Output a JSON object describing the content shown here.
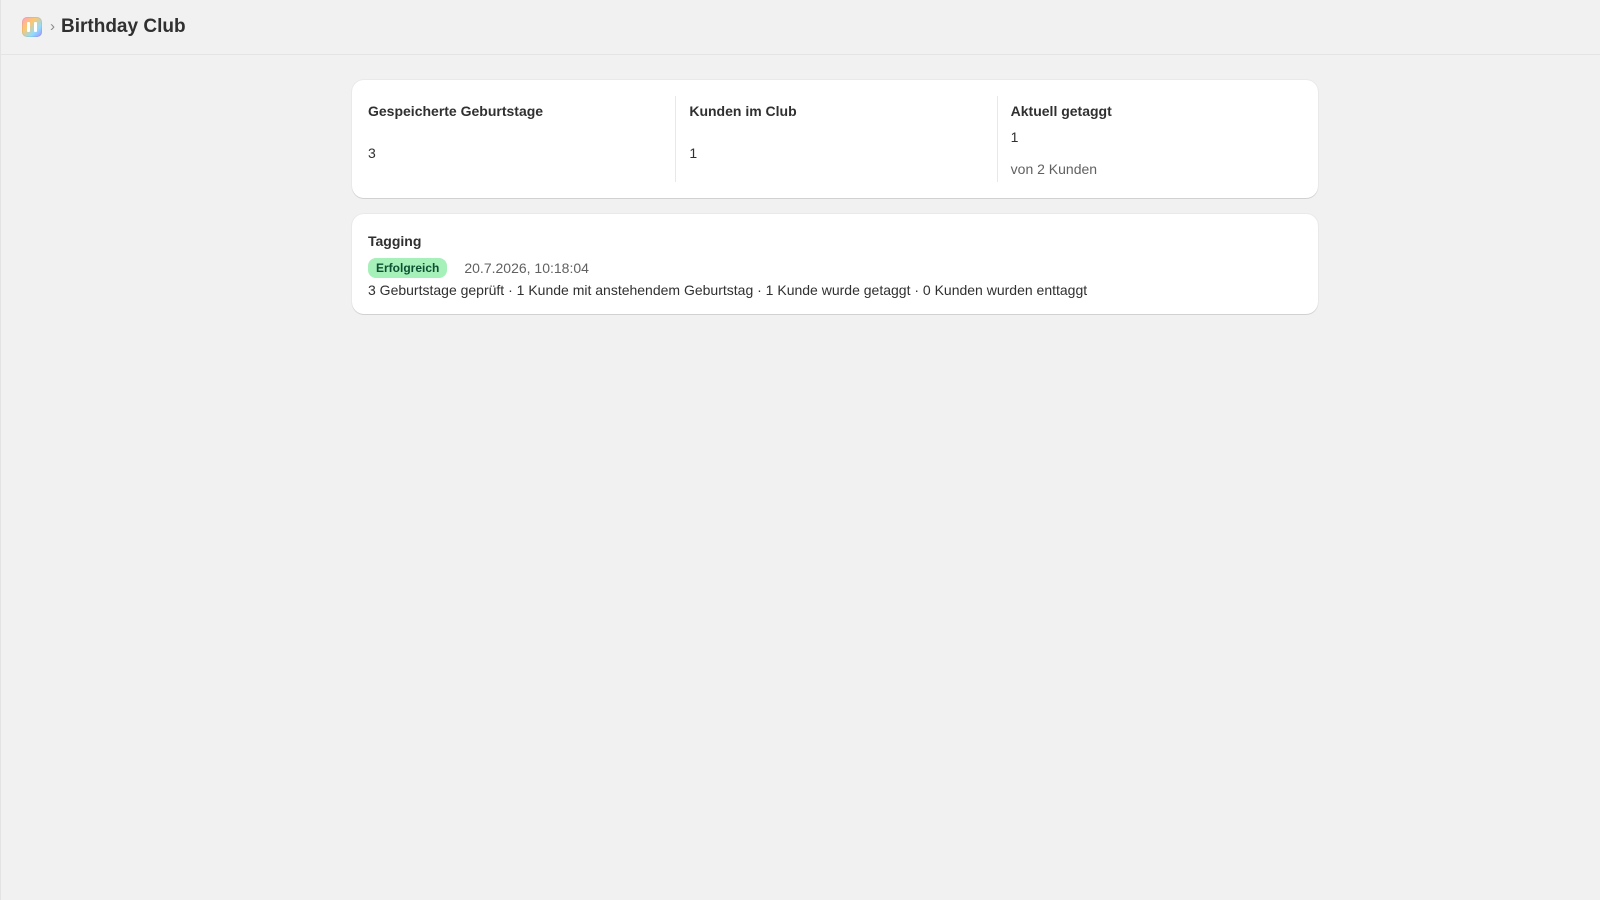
{
  "header": {
    "app_icon": "app-logo-icon",
    "separator": "›",
    "title": "Birthday Club"
  },
  "stats": {
    "saved_birthdays": {
      "label": "Gespeicherte Geburtstage",
      "value": "3"
    },
    "club_customers": {
      "label": "Kunden im Club",
      "value": "1"
    },
    "currently_tagged": {
      "label": "Aktuell getaggt",
      "value": "1",
      "sub": "von 2 Kunden"
    }
  },
  "tagging": {
    "title": "Tagging",
    "status": "Erfolgreich",
    "status_color": "#a6f0b9",
    "timestamp": "20.7.2026, 10:18:04",
    "summary": "3 Geburtstage geprüft · 1 Kunde mit anstehendem Geburtstag · 1 Kunde wurde getaggt · 0 Kunden wurden enttaggt"
  }
}
